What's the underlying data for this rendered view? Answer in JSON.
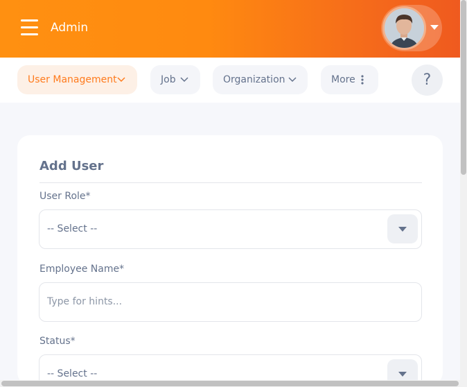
{
  "header": {
    "title": "Admin",
    "icons": {
      "menu": "hamburger-menu-icon",
      "account": "chevron-down-icon"
    },
    "accent_start": "#ff9011",
    "accent_end": "#ef5a1f"
  },
  "nav": {
    "items": [
      {
        "label": "User Management",
        "icon": "chevron-down-icon"
      },
      {
        "label": "Job",
        "icon": "chevron-down-icon"
      },
      {
        "label": "Organization",
        "icon": "chevron-down-icon"
      },
      {
        "label": "More",
        "icon": "more-vertical-icon"
      }
    ],
    "help_label": "?"
  },
  "form": {
    "title": "Add User",
    "user_role": {
      "label": "User Role*",
      "value": "-- Select --"
    },
    "employee_name": {
      "label": "Employee Name*",
      "placeholder": "Type for hints..."
    },
    "status": {
      "label": "Status*",
      "value": "-- Select --"
    }
  }
}
